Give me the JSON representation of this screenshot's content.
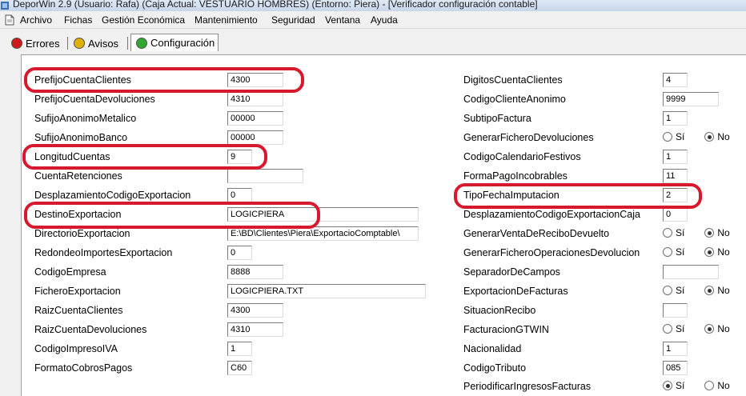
{
  "window": {
    "title": "DeporWin 2.9  (Usuario: Rafa)  (Caja Actual: VESTUARIO HOMBRES) (Entorno: Piera) - [Verificador configuración contable]"
  },
  "menu": [
    "Archivo",
    "Fichas",
    "Gestión Económica",
    "Mantenimiento",
    "Seguridad",
    "Ventana",
    "Ayuda"
  ],
  "tabs": [
    "Errores",
    "Avisos",
    "Configuración"
  ],
  "tab_colors": {
    "errores": "#cc1a1a",
    "avisos": "#e0b000",
    "configuracion": "#2ea82e"
  },
  "accent": {
    "highlight": "#d8182c"
  },
  "left_fields": [
    {
      "label": "PrefijoCuentaClientes",
      "value": "4300"
    },
    {
      "label": "PrefijoCuentaDevoluciones",
      "value": "4310"
    },
    {
      "label": "SufijoAnonimoMetalico",
      "value": "00000"
    },
    {
      "label": "SufijoAnonimoBanco",
      "value": "00000"
    },
    {
      "label": "LongitudCuentas",
      "value": "9"
    },
    {
      "label": "CuentaRetenciones",
      "value": ""
    },
    {
      "label": "DesplazamientoCodigoExportacion",
      "value": "0"
    },
    {
      "label": "DestinoExportacion",
      "value": "LOGICPIERA"
    },
    {
      "label": "DirectorioExportacion",
      "value": "E:\\BD\\Clientes\\Piera\\ExportacioComptable\\"
    },
    {
      "label": "RedondeoImportesExportacion",
      "value": "0"
    },
    {
      "label": "CodigoEmpresa",
      "value": "8888"
    },
    {
      "label": "FicheroExportacion",
      "value": "LOGICPIERA.TXT"
    },
    {
      "label": "RaizCuentaClientes",
      "value": "4300"
    },
    {
      "label": "RaizCuentaDevoluciones",
      "value": "4310"
    },
    {
      "label": "CodigoImpresoIVA",
      "value": "1"
    },
    {
      "label": "FormatoCobrosPagos",
      "value": "C60"
    }
  ],
  "right_fields": [
    {
      "label": "DigitosCuentaClientes",
      "value": "4"
    },
    {
      "label": "CodigoClienteAnonimo",
      "value": "9999"
    },
    {
      "label": "SubtipoFactura",
      "value": "1"
    },
    {
      "label": "GenerarFicheroDevoluciones",
      "yes": "Sí",
      "no": "No",
      "selected": "No"
    },
    {
      "label": "CodigoCalendarioFestivos",
      "value": "1"
    },
    {
      "label": "FormaPagoIncobrables",
      "value": "11"
    },
    {
      "label": "TipoFechaImputacion",
      "value": "2"
    },
    {
      "label": "DesplazamientoCodigoExportacionCaja",
      "value": "0"
    },
    {
      "label": "GenerarVentaDeReciboDevuelto",
      "yes": "Sí",
      "no": "No",
      "selected": "No"
    },
    {
      "label": "GenerarFicheroOperacionesDevolucion",
      "yes": "Sí",
      "no": "No",
      "selected": "No"
    },
    {
      "label": "SeparadorDeCampos",
      "value": ""
    },
    {
      "label": "ExportacionDeFacturas",
      "yes": "Sí",
      "no": "No",
      "selected": "No"
    },
    {
      "label": "SituacionRecibo",
      "value": ""
    },
    {
      "label": "FacturacionGTWIN",
      "yes": "Sí",
      "no": "No",
      "selected": "No"
    },
    {
      "label": "Nacionalidad",
      "value": "1"
    },
    {
      "label": "CodigoTributo",
      "value": "085"
    },
    {
      "label": "PeriodificarIngresosFacturas",
      "yes": "Sí",
      "no": "No",
      "selected": "Sí"
    }
  ]
}
